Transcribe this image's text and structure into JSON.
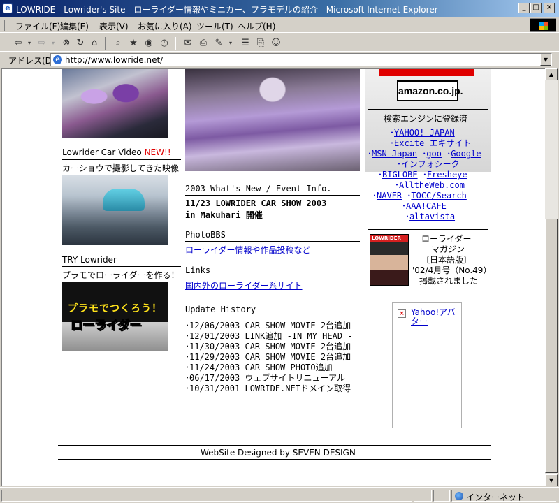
{
  "window": {
    "title": "LOWRIDE - Lowrider's Site - ローライダー情報やミニカー、プラモデルの紹介 - Microsoft Internet Explorer",
    "app_icon": "e",
    "buttons": {
      "minimize": "_",
      "maximize": "□",
      "close": "×"
    }
  },
  "menu": [
    "ファイル(F)",
    "編集(E)",
    "表示(V)",
    "お気に入り(A)",
    "ツール(T)",
    "ヘルプ(H)"
  ],
  "toolbar_icons": [
    "back-arrow-icon",
    "forward-arrow-icon",
    "stop-icon",
    "refresh-icon",
    "home-icon",
    "search-icon",
    "favorites-icon",
    "history-icon",
    "mail-icon",
    "print-icon",
    "edit-icon",
    "discuss-icon",
    "messenger-icon"
  ],
  "address": {
    "label": "アドレス(D)",
    "url": "http://www.lowride.net/"
  },
  "status": {
    "zone": "インターネット"
  },
  "left": {
    "video_title": "Lowrider Car Video",
    "video_new": "NEW!!",
    "video_desc": "カーショウで撮影してきた映像",
    "try_title": "TRY Lowrider",
    "try_desc": "プラモでローライダーを作る！",
    "plamo_line1": "プラモでつくろう！",
    "plamo_line2": "ローライダー"
  },
  "center": {
    "news_heading": "2003 What's New / Event Info.",
    "news_line1": "11/23  LOWRIDER CAR SHOW 2003",
    "news_line2": "in Makuhari 開催",
    "bbs_heading": "PhotoBBS",
    "bbs_link": "ローライダー情報や作品投稿など",
    "links_heading": "Links",
    "links_link": "国内外のローライダー系サイト",
    "history_heading": "Update History",
    "history": [
      "･12/06/2003  CAR SHOW MOVIE 2台追加",
      "･12/01/2003  LINK追加 -IN MY HEAD -",
      "･11/30/2003  CAR SHOW MOVIE 2台追加",
      "･11/29/2003  CAR SHOW MOVIE 2台追加",
      "･11/24/2003  CAR SHOW PHOTO追加",
      "･06/17/2003  ウェブサイトリニューアル",
      "･10/31/2001  LOWRIDE.NETドメイン取得"
    ]
  },
  "right": {
    "amazon_logo": "amazon.co.jp.",
    "search_heading": "検索エンジンに登録済",
    "engines": [
      [
        "YAHOO! JAPAN"
      ],
      [
        "Excite エキサイト"
      ],
      [
        "MSN Japan",
        "goo",
        "Google"
      ],
      [
        "インフォシーク"
      ],
      [
        "BIGLOBE",
        "Fresheye"
      ],
      [
        "AlltheWeb.com"
      ],
      [
        "NAVER",
        "TOCC/Search"
      ],
      [
        "AAA!CAFE"
      ],
      [
        "altavista"
      ]
    ],
    "magazine_cover": "LOWRIDER",
    "magazine_text": [
      "ローライダー",
      "マガジン",
      "〔日本語版〕",
      "'02/4月号（No.49）",
      "掲載されました"
    ],
    "yahoo_avatar_alt": "Yahoo!アバター"
  },
  "footer": {
    "credit": "WebSite Designed by SEVEN DESIGN"
  }
}
